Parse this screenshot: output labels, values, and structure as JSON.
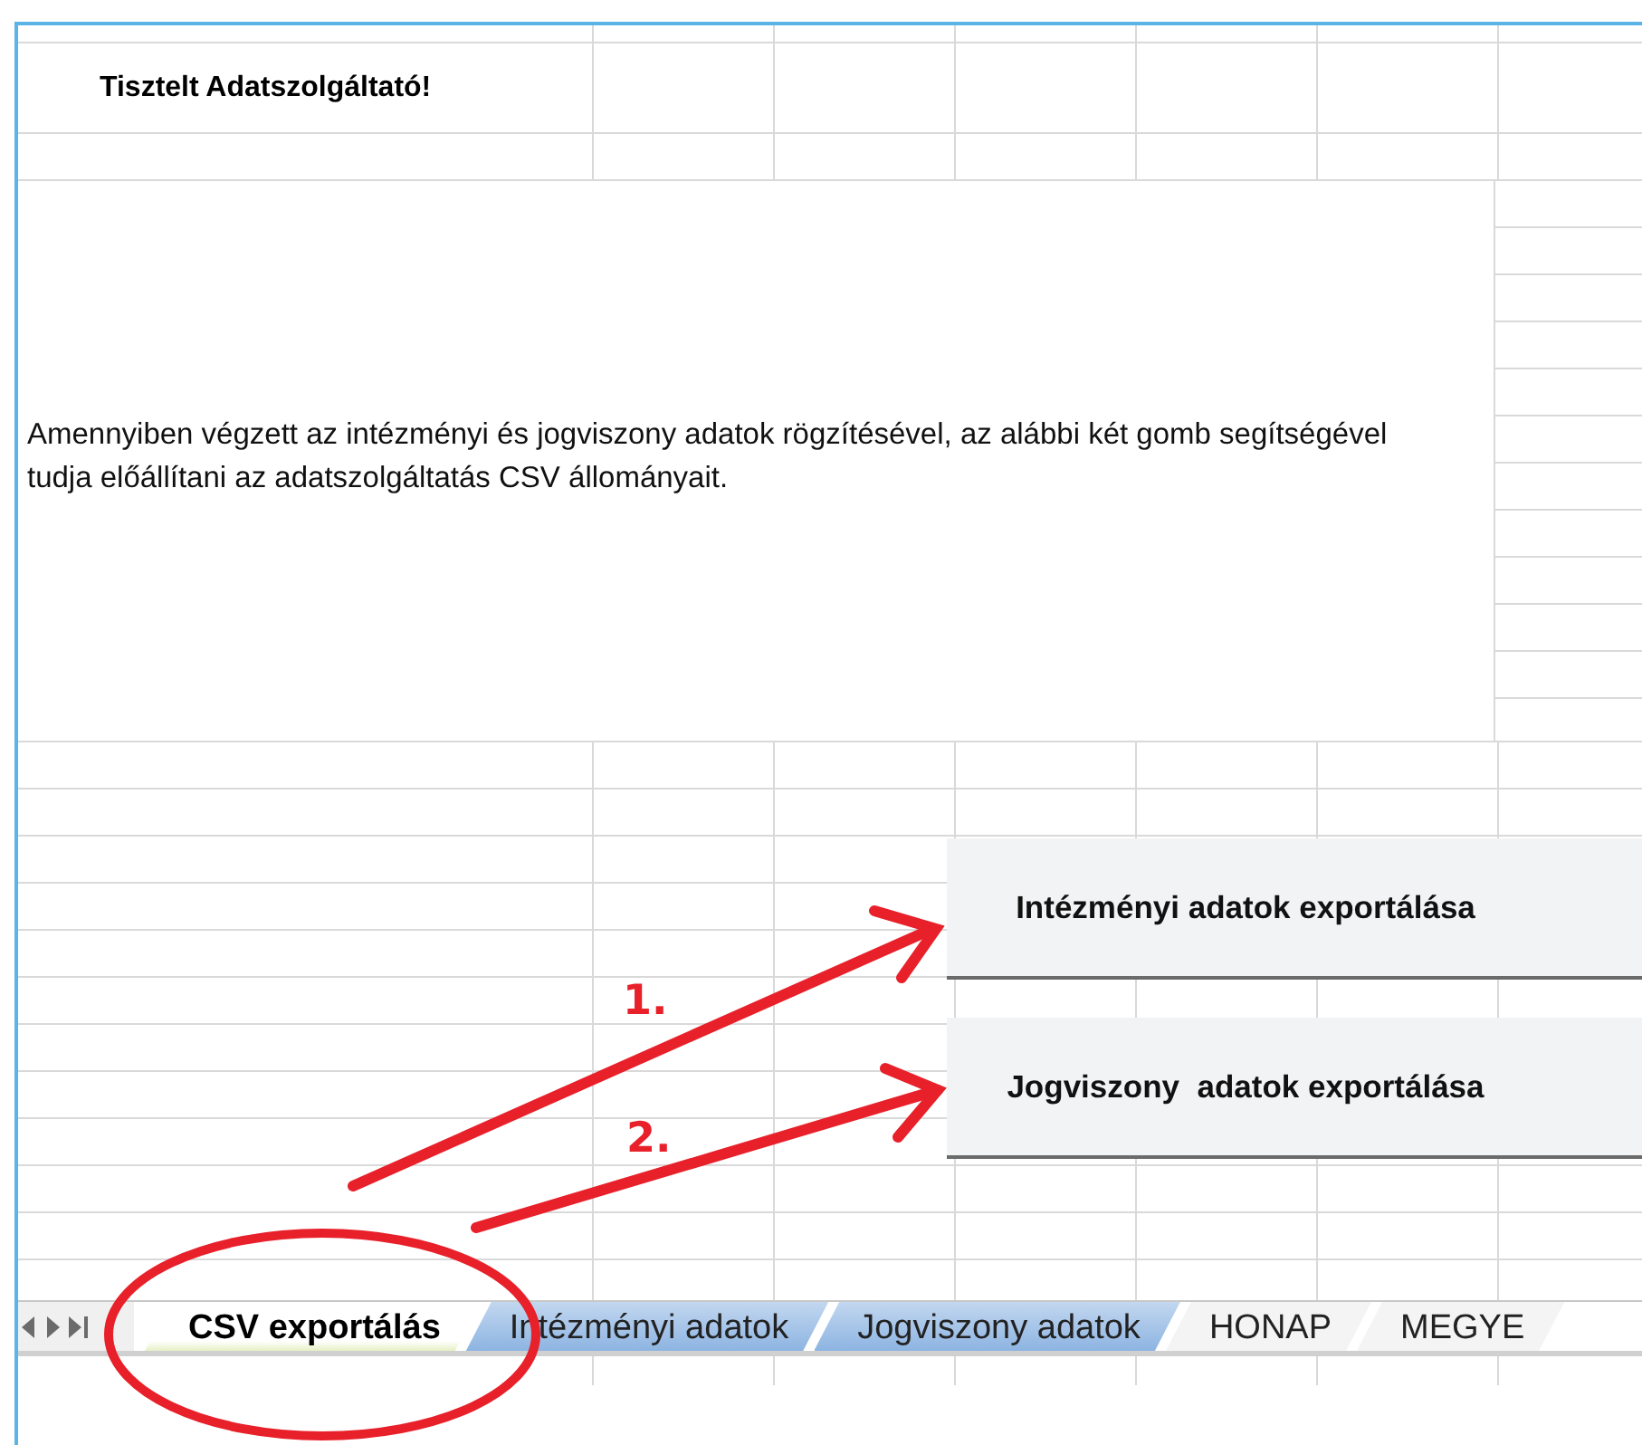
{
  "greeting": "Tisztelt Adatszolgáltató!",
  "message": "Amennyiben végzett az intézményi és jogviszony adatok rögzítésével, az alábbi két gomb segítségével tudja előállítani az adatszolgáltatás CSV állományait.",
  "buttons": [
    {
      "label": "Intézményi adatok exportálása"
    },
    {
      "label": "Jogviszony  adatok exportálása"
    }
  ],
  "annotations": [
    {
      "label": "1."
    },
    {
      "label": "2."
    }
  ],
  "sheet_tabs": [
    {
      "label": "CSV exportálás",
      "selected": true
    },
    {
      "label": "Intézményi adatok",
      "selected": false,
      "color": "#8db4e2"
    },
    {
      "label": "Jogviszony adatok",
      "selected": false,
      "color": "#8db4e2"
    },
    {
      "label": "HONAP",
      "selected": false
    },
    {
      "label": "MEGYE",
      "selected": false
    }
  ]
}
